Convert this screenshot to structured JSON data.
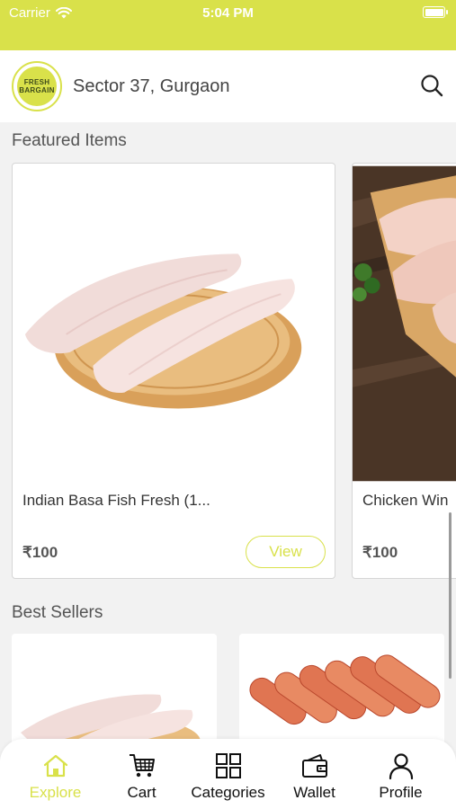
{
  "status_bar": {
    "carrier": "Carrier",
    "time": "5:04 PM"
  },
  "header": {
    "logo_text_line1": "FRESH",
    "logo_text_line2": "BARGAIN",
    "location": "Sector 37, Gurgaon"
  },
  "featured": {
    "title": "Featured Items",
    "items": [
      {
        "name": "Indian Basa Fish Fresh (1...",
        "price": "₹100",
        "action": "View"
      },
      {
        "name": "Chicken Win",
        "price": "₹100"
      }
    ]
  },
  "best_sellers": {
    "title": "Best Sellers"
  },
  "tabs": [
    {
      "label": "Explore",
      "icon": "home-icon",
      "active": true
    },
    {
      "label": "Cart",
      "icon": "cart-icon"
    },
    {
      "label": "Categories",
      "icon": "grid-icon"
    },
    {
      "label": "Wallet",
      "icon": "wallet-icon"
    },
    {
      "label": "Profile",
      "icon": "person-icon"
    }
  ],
  "colors": {
    "accent": "#d9e14a",
    "background": "#f2f2f2"
  }
}
